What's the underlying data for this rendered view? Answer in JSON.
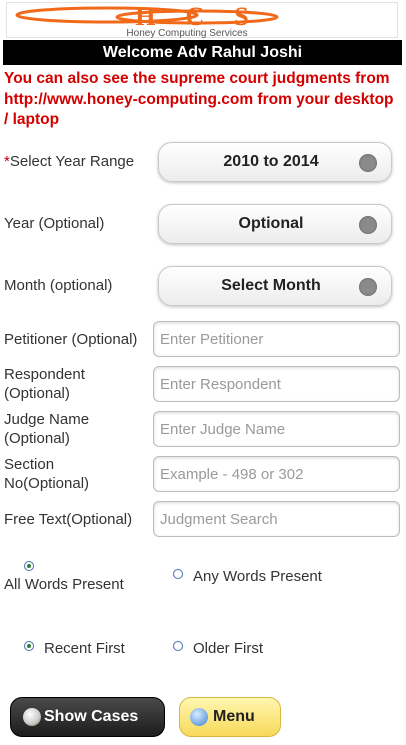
{
  "logo": {
    "letters": "HCS",
    "tagline": "Honey Computing Services"
  },
  "header": {
    "welcome": "Welcome Adv Rahul Joshi"
  },
  "notice": "You can also see the supreme court judgments from http://www.honey-computing.com from your desktop / laptop",
  "form": {
    "year_range": {
      "required_mark": "*",
      "label": "Select Year Range",
      "value": "2010 to 2014"
    },
    "year": {
      "label": "Year (Optional)",
      "value": "Optional"
    },
    "month": {
      "label": "Month (optional)",
      "value": "Select Month"
    },
    "petitioner": {
      "label": "Petitioner (Optional)",
      "placeholder": "Enter Petitioner"
    },
    "respondent": {
      "label_line1": "Respondent",
      "label_line2": "(Optional)",
      "placeholder": "Enter Respondent"
    },
    "judge": {
      "label_line1": "Judge Name",
      "label_line2": "(Optional)",
      "placeholder": "Enter Judge Name"
    },
    "section": {
      "label_line1": "Section",
      "label_line2": "No(Optional)",
      "placeholder": "Example - 498 or 302"
    },
    "free_text": {
      "label": "Free Text(Optional)",
      "placeholder": "Judgment Search"
    },
    "match_options": [
      {
        "label": "All Words Present",
        "selected": true
      },
      {
        "label": "Any Words Present",
        "selected": false
      }
    ],
    "order_options": [
      {
        "label": "Recent First",
        "selected": true
      },
      {
        "label": "Older First",
        "selected": false
      }
    ]
  },
  "buttons": {
    "show_cases": "Show Cases",
    "menu": "Menu"
  },
  "icons": {
    "show_cases": "cases-icon",
    "menu": "menu-icon",
    "select_indicator": "dropdown-dot-icon"
  },
  "colors": {
    "notice_red": "#d40000",
    "logo_orange": "#f06a1a",
    "header_bg": "#000000",
    "menu_yellow": "#f7d95a"
  }
}
